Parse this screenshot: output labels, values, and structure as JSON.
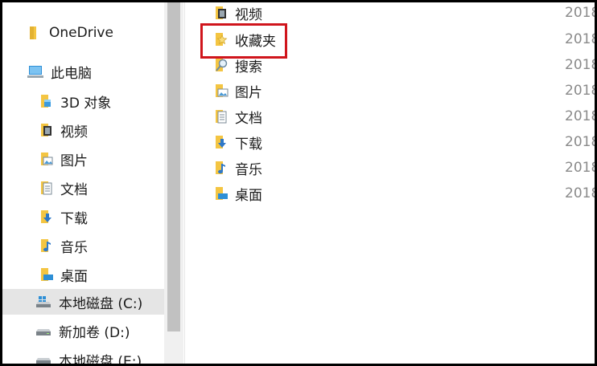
{
  "nav": {
    "items": [
      {
        "label": "OneDrive",
        "icon": "onedrive-folder-icon"
      },
      {
        "label": "此电脑",
        "icon": "this-pc-icon"
      },
      {
        "label": "3D 对象",
        "icon": "3d-objects-folder-icon"
      },
      {
        "label": "视频",
        "icon": "videos-folder-icon"
      },
      {
        "label": "图片",
        "icon": "pictures-folder-icon"
      },
      {
        "label": "文档",
        "icon": "documents-folder-icon"
      },
      {
        "label": "下载",
        "icon": "downloads-folder-icon"
      },
      {
        "label": "音乐",
        "icon": "music-folder-icon"
      },
      {
        "label": "桌面",
        "icon": "desktop-folder-icon"
      },
      {
        "label": "本地磁盘 (C:)",
        "icon": "system-drive-icon",
        "selected": true
      },
      {
        "label": "新加卷 (D:)",
        "icon": "drive-icon"
      },
      {
        "label": "本地磁盘 (E:)",
        "icon": "drive-icon"
      }
    ]
  },
  "content": {
    "rows": [
      {
        "name": "视频",
        "date": "2018",
        "icon": "videos-folder-icon"
      },
      {
        "name": "收藏夹",
        "date": "2018",
        "icon": "favorites-folder-icon",
        "highlighted": true
      },
      {
        "name": "搜索",
        "date": "2018",
        "icon": "searches-folder-icon"
      },
      {
        "name": "图片",
        "date": "2018",
        "icon": "pictures-folder-icon"
      },
      {
        "name": "文档",
        "date": "2018",
        "icon": "documents-folder-icon"
      },
      {
        "name": "下载",
        "date": "2018",
        "icon": "downloads-folder-icon"
      },
      {
        "name": "音乐",
        "date": "2018",
        "icon": "music-folder-icon"
      },
      {
        "name": "桌面",
        "date": "2018",
        "icon": "desktop-folder-icon"
      }
    ]
  },
  "colors": {
    "folder": "#f4c542",
    "folder_dark": "#dca92a",
    "highlight_border": "#d0151c",
    "selected_bg": "#e5e5e5"
  }
}
